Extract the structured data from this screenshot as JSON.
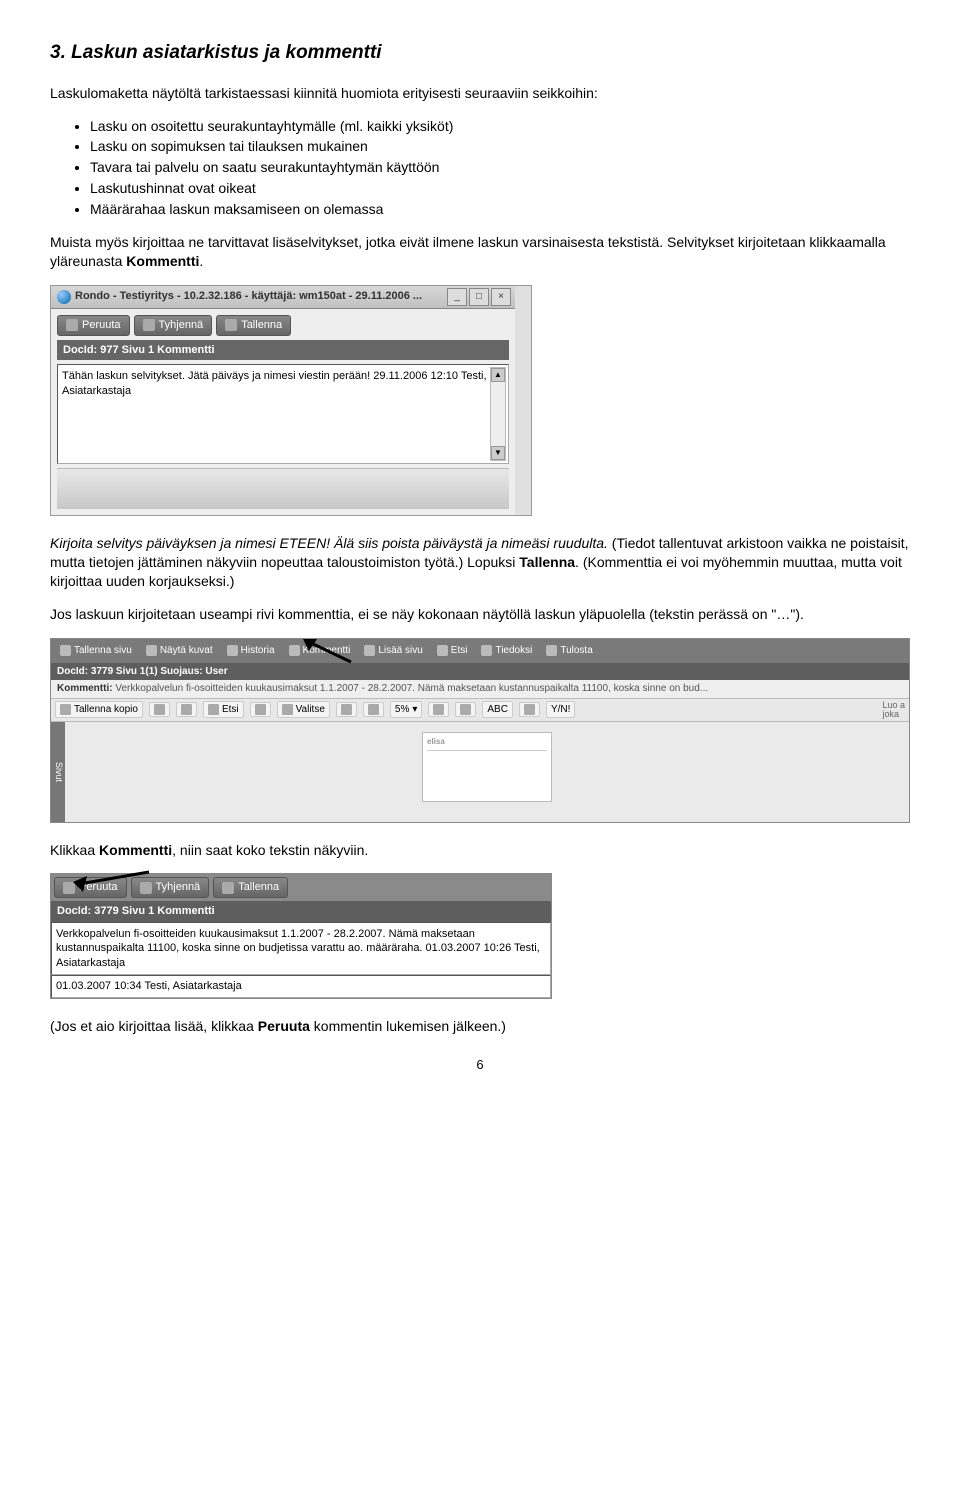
{
  "heading": "3. Laskun asiatarkistus ja kommentti",
  "intro": "Laskulomaketta näytöltä tarkistaessasi kiinnitä huomiota erityisesti seuraaviin seikkoihin:",
  "bullets": [
    "Lasku on osoitettu seurakuntayhtymälle (ml. kaikki yksiköt)",
    "Lasku on sopimuksen tai tilauksen mukainen",
    "Tavara tai palvelu on saatu seurakuntayhtymän käyttöön",
    "Laskutushinnat ovat oikeat",
    "Määrärahaa laskun maksamiseen on olemassa"
  ],
  "para1_a": "Muista myös kirjoittaa ne tarvittavat lisäselvitykset, jotka eivät ilmene laskun varsinaisesta tekstistä. Selvitykset kirjoitetaan klikkaamalla yläreunasta ",
  "para1_b": "Kommentti",
  "win1": {
    "title": "Rondo - Testiyritys - 10.2.32.186 - käyttäjä: wm150at - 29.11.2006 ...",
    "btn_peruuta": "Peruuta",
    "btn_tyhjenna": "Tyhjennä",
    "btn_tallenna": "Tallenna",
    "docbar": "DocId: 977  Sivu 1  Kommentti",
    "textarea": "Tähän laskun selvitykset. Jätä päiväys ja nimesi viestin perään! 29.11.2006 12:10 Testi, Asiatarkastaja"
  },
  "para2_a": "Kirjoita selvitys päiväyksen ja nimesi ETEEN! Älä siis poista päiväystä ja nimeäsi ruudulta.",
  "para2_b": " (Tiedot tallentuvat arkistoon vaikka ne poistaisit, mutta tietojen jättäminen näkyviin nopeuttaa taloustoimiston työtä.) Lopuksi ",
  "para2_c": "Tallenna",
  "para2_d": ". (Kommenttia ei voi myöhemmin muuttaa, mutta voit kirjoittaa uuden korjaukseksi.)",
  "para3": "Jos laskuun kirjoitetaan useampi rivi kommenttia, ei se näy kokonaan näytöllä laskun yläpuolella (tekstin perässä on \"…\").",
  "wide": {
    "tabs": [
      "Tallenna sivu",
      "Näytä kuvat",
      "Historia",
      "Kommentti",
      "Lisää sivu",
      "Etsi",
      "Tiedoksi",
      "Tulosta"
    ],
    "docbar": "DocId: 3779  Sivu 1(1)  Suojaus: User",
    "comment_label": "Kommentti:",
    "comment_text": "Verkkopalvelun fi-osoitteiden kuukausimaksut 1.1.2007 - 28.2.2007. Nämä maksetaan kustannuspaikalta 11100, koska sinne on bud...",
    "tb2": {
      "tallenna_kopio": "Tallenna kopio",
      "etsi": "Etsi",
      "valitse": "Valitse",
      "zoom": "5%",
      "luo": "Luo a",
      "joka": "joka"
    },
    "sidebar": "Sivut",
    "doc_word": "elisa"
  },
  "para4_a": "Klikkaa ",
  "para4_b": "Kommentti",
  "para4_c": ", niin saat koko tekstin näkyviin.",
  "win3": {
    "btn_peruuta": "Peruuta",
    "btn_tyhjenna": "Tyhjennä",
    "btn_tallenna": "Tallenna",
    "docbar": "DocId: 3779  Sivu 1  Kommentti",
    "text": "Verkkopalvelun fi-osoitteiden kuukausimaksut 1.1.2007 - 28.2.2007. Nämä maksetaan kustannuspaikalta 11100, koska sinne on budjetissa varattu ao. määräraha. 01.03.2007 10:26 Testi, Asiatarkastaja",
    "input": "01.03.2007 10:34 Testi, Asiatarkastaja"
  },
  "para5_a": "(Jos et aio kirjoittaa lisää, klikkaa ",
  "para5_b": "Peruuta",
  "para5_c": " kommentin lukemisen jälkeen.)",
  "page_number": "6"
}
